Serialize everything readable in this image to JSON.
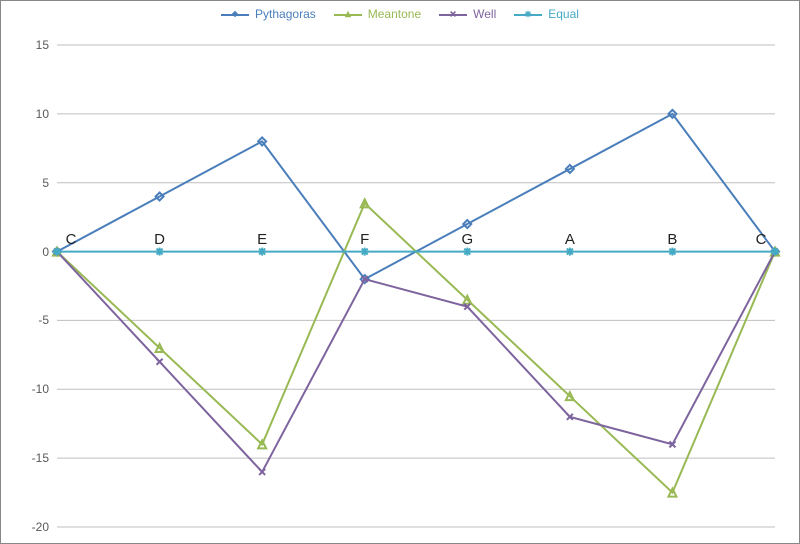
{
  "chart_data": {
    "type": "line",
    "categories": [
      "C",
      "D",
      "E",
      "F",
      "G",
      "A",
      "B",
      "C"
    ],
    "ylim": [
      -20,
      15
    ],
    "yticks": [
      -20,
      -15,
      -10,
      -5,
      0,
      5,
      10,
      15
    ],
    "series": [
      {
        "name": "Pythagoras",
        "color": "#4A7EBB",
        "marker": "diamond",
        "values": [
          0,
          4.0,
          8.0,
          -2.0,
          2.0,
          6.0,
          10.0,
          0
        ]
      },
      {
        "name": "Meantone",
        "color": "#98B954",
        "marker": "triangle",
        "values": [
          0,
          -7.0,
          -14.0,
          3.5,
          -3.5,
          -10.5,
          -17.5,
          0
        ]
      },
      {
        "name": "Well",
        "color": "#7E649E",
        "marker": "x",
        "values": [
          0,
          -8.0,
          -16.0,
          -2.0,
          -4.0,
          -12.0,
          -14.0,
          0
        ]
      },
      {
        "name": "Equal",
        "color": "#46AAC5",
        "marker": "star",
        "values": [
          0,
          0,
          0,
          0,
          0,
          0,
          0,
          0
        ]
      }
    ],
    "title": "",
    "xlabel": "",
    "ylabel": ""
  },
  "legend": {
    "items": [
      {
        "label": "Pythagoras"
      },
      {
        "label": "Meantone"
      },
      {
        "label": "Well"
      },
      {
        "label": "Equal"
      }
    ]
  }
}
